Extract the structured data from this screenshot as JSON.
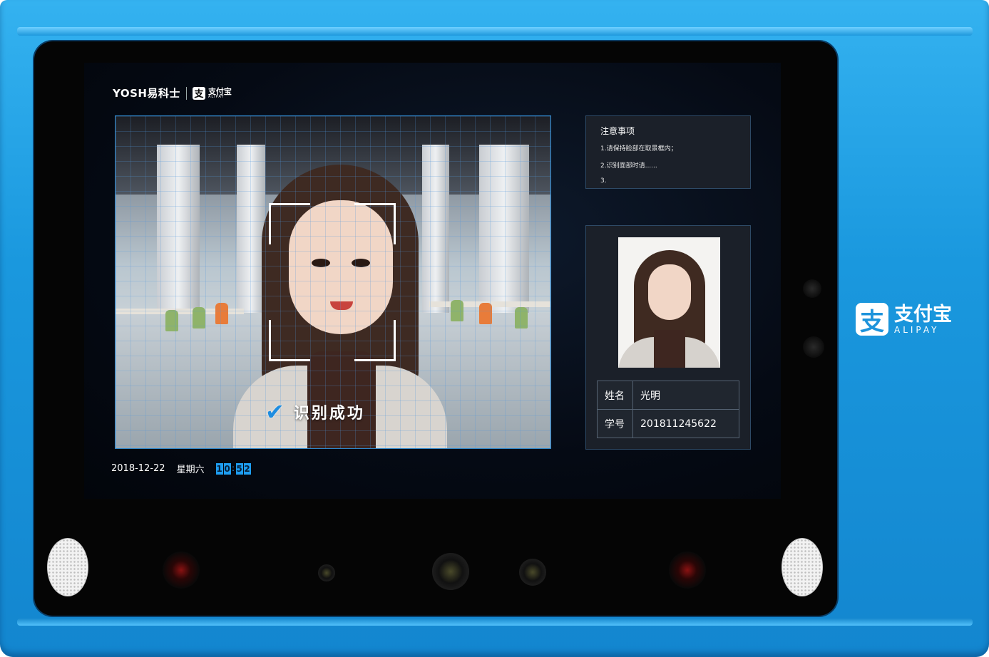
{
  "brand": {
    "yosh": "YOSH易科士",
    "alipay_cn": "支付宝",
    "alipay_en": "ALIPAY",
    "alipay_icon": "支"
  },
  "camera": {
    "success_text": "识别成功",
    "check_icon": "✔"
  },
  "footer": {
    "date": "2018-12-22",
    "weekday": "星期六",
    "clock_digits": [
      "1",
      "0",
      "5",
      "2"
    ],
    "clock_sep": ":"
  },
  "notice": {
    "title": "注意事项",
    "items": [
      "1.请保持脸部在取景框内；",
      "2.识别面部时请......",
      "3."
    ]
  },
  "person": {
    "name_key": "姓名",
    "name_value": "光明",
    "id_key": "学号",
    "id_value": "201811245622"
  },
  "side_brand": {
    "icon": "支",
    "cn": "支付宝",
    "en": "ALIPAY"
  },
  "colors": {
    "device_blue": "#1a98de",
    "accent": "#1e9df0",
    "frame": "#2f86c9"
  }
}
